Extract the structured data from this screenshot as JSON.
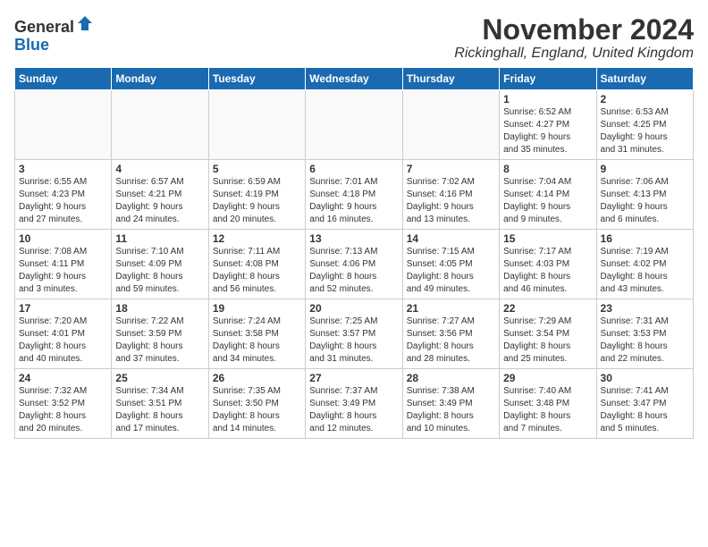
{
  "header": {
    "logo_general": "General",
    "logo_blue": "Blue",
    "month_title": "November 2024",
    "location": "Rickinghall, England, United Kingdom"
  },
  "weekdays": [
    "Sunday",
    "Monday",
    "Tuesday",
    "Wednesday",
    "Thursday",
    "Friday",
    "Saturday"
  ],
  "weeks": [
    [
      {
        "day": "",
        "info": ""
      },
      {
        "day": "",
        "info": ""
      },
      {
        "day": "",
        "info": ""
      },
      {
        "day": "",
        "info": ""
      },
      {
        "day": "",
        "info": ""
      },
      {
        "day": "1",
        "info": "Sunrise: 6:52 AM\nSunset: 4:27 PM\nDaylight: 9 hours\nand 35 minutes."
      },
      {
        "day": "2",
        "info": "Sunrise: 6:53 AM\nSunset: 4:25 PM\nDaylight: 9 hours\nand 31 minutes."
      }
    ],
    [
      {
        "day": "3",
        "info": "Sunrise: 6:55 AM\nSunset: 4:23 PM\nDaylight: 9 hours\nand 27 minutes."
      },
      {
        "day": "4",
        "info": "Sunrise: 6:57 AM\nSunset: 4:21 PM\nDaylight: 9 hours\nand 24 minutes."
      },
      {
        "day": "5",
        "info": "Sunrise: 6:59 AM\nSunset: 4:19 PM\nDaylight: 9 hours\nand 20 minutes."
      },
      {
        "day": "6",
        "info": "Sunrise: 7:01 AM\nSunset: 4:18 PM\nDaylight: 9 hours\nand 16 minutes."
      },
      {
        "day": "7",
        "info": "Sunrise: 7:02 AM\nSunset: 4:16 PM\nDaylight: 9 hours\nand 13 minutes."
      },
      {
        "day": "8",
        "info": "Sunrise: 7:04 AM\nSunset: 4:14 PM\nDaylight: 9 hours\nand 9 minutes."
      },
      {
        "day": "9",
        "info": "Sunrise: 7:06 AM\nSunset: 4:13 PM\nDaylight: 9 hours\nand 6 minutes."
      }
    ],
    [
      {
        "day": "10",
        "info": "Sunrise: 7:08 AM\nSunset: 4:11 PM\nDaylight: 9 hours\nand 3 minutes."
      },
      {
        "day": "11",
        "info": "Sunrise: 7:10 AM\nSunset: 4:09 PM\nDaylight: 8 hours\nand 59 minutes."
      },
      {
        "day": "12",
        "info": "Sunrise: 7:11 AM\nSunset: 4:08 PM\nDaylight: 8 hours\nand 56 minutes."
      },
      {
        "day": "13",
        "info": "Sunrise: 7:13 AM\nSunset: 4:06 PM\nDaylight: 8 hours\nand 52 minutes."
      },
      {
        "day": "14",
        "info": "Sunrise: 7:15 AM\nSunset: 4:05 PM\nDaylight: 8 hours\nand 49 minutes."
      },
      {
        "day": "15",
        "info": "Sunrise: 7:17 AM\nSunset: 4:03 PM\nDaylight: 8 hours\nand 46 minutes."
      },
      {
        "day": "16",
        "info": "Sunrise: 7:19 AM\nSunset: 4:02 PM\nDaylight: 8 hours\nand 43 minutes."
      }
    ],
    [
      {
        "day": "17",
        "info": "Sunrise: 7:20 AM\nSunset: 4:01 PM\nDaylight: 8 hours\nand 40 minutes."
      },
      {
        "day": "18",
        "info": "Sunrise: 7:22 AM\nSunset: 3:59 PM\nDaylight: 8 hours\nand 37 minutes."
      },
      {
        "day": "19",
        "info": "Sunrise: 7:24 AM\nSunset: 3:58 PM\nDaylight: 8 hours\nand 34 minutes."
      },
      {
        "day": "20",
        "info": "Sunrise: 7:25 AM\nSunset: 3:57 PM\nDaylight: 8 hours\nand 31 minutes."
      },
      {
        "day": "21",
        "info": "Sunrise: 7:27 AM\nSunset: 3:56 PM\nDaylight: 8 hours\nand 28 minutes."
      },
      {
        "day": "22",
        "info": "Sunrise: 7:29 AM\nSunset: 3:54 PM\nDaylight: 8 hours\nand 25 minutes."
      },
      {
        "day": "23",
        "info": "Sunrise: 7:31 AM\nSunset: 3:53 PM\nDaylight: 8 hours\nand 22 minutes."
      }
    ],
    [
      {
        "day": "24",
        "info": "Sunrise: 7:32 AM\nSunset: 3:52 PM\nDaylight: 8 hours\nand 20 minutes."
      },
      {
        "day": "25",
        "info": "Sunrise: 7:34 AM\nSunset: 3:51 PM\nDaylight: 8 hours\nand 17 minutes."
      },
      {
        "day": "26",
        "info": "Sunrise: 7:35 AM\nSunset: 3:50 PM\nDaylight: 8 hours\nand 14 minutes."
      },
      {
        "day": "27",
        "info": "Sunrise: 7:37 AM\nSunset: 3:49 PM\nDaylight: 8 hours\nand 12 minutes."
      },
      {
        "day": "28",
        "info": "Sunrise: 7:38 AM\nSunset: 3:49 PM\nDaylight: 8 hours\nand 10 minutes."
      },
      {
        "day": "29",
        "info": "Sunrise: 7:40 AM\nSunset: 3:48 PM\nDaylight: 8 hours\nand 7 minutes."
      },
      {
        "day": "30",
        "info": "Sunrise: 7:41 AM\nSunset: 3:47 PM\nDaylight: 8 hours\nand 5 minutes."
      }
    ]
  ]
}
